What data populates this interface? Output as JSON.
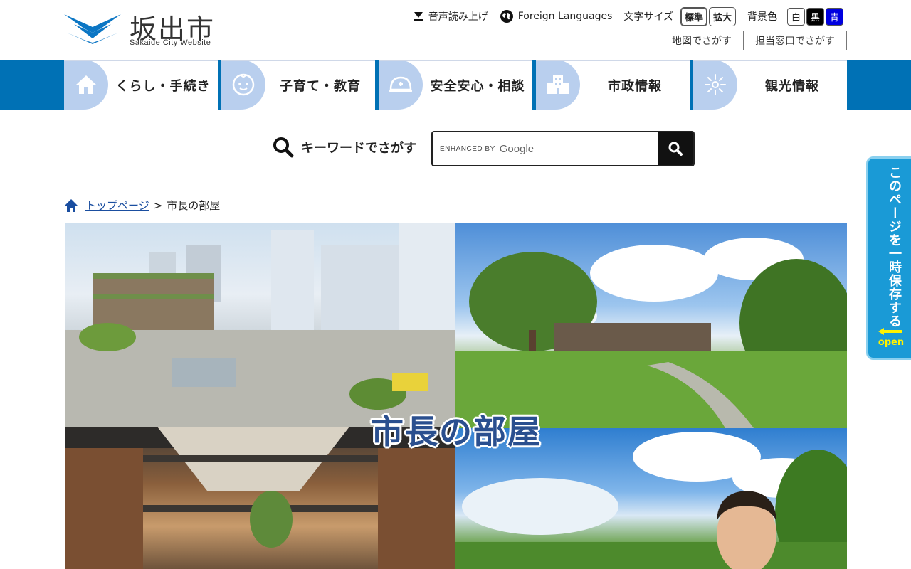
{
  "header": {
    "logo_title": "坂出市",
    "logo_subtitle": "Sakaide City Website",
    "utility": {
      "voice_label": "音声読み上げ",
      "foreign_label": "Foreign Languages",
      "text_size_label": "文字サイズ",
      "size_standard": "標準",
      "size_large": "拡大",
      "bg_label": "背景色",
      "bg_white": "白",
      "bg_black": "黒",
      "bg_blue": "青"
    },
    "sub_links": [
      "地図でさがす",
      "担当窓口でさがす"
    ]
  },
  "nav": {
    "items": [
      {
        "label": "くらし・手続き",
        "icon": "house-icon"
      },
      {
        "label": "子育て・教育",
        "icon": "baby-icon"
      },
      {
        "label": "安全安心・相談",
        "icon": "helmet-icon"
      },
      {
        "label": "市政情報",
        "icon": "building-icon"
      },
      {
        "label": "観光情報",
        "icon": "firework-icon"
      }
    ]
  },
  "search": {
    "label": "キーワードでさがす",
    "enhanced_by": "ENHANCED BY",
    "google": "Google"
  },
  "breadcrumb": {
    "home": "トップページ",
    "separator": ">",
    "current": "市長の部屋"
  },
  "hero": {
    "title": "市長の部屋"
  },
  "side_tab": {
    "text": "このページを一時保存する",
    "open": "open"
  },
  "colors": {
    "nav_band": "#0071b5",
    "nav_icon_bg": "#b9cfee",
    "side_tab": "#1a9ad6",
    "link": "#1a4ea0"
  }
}
